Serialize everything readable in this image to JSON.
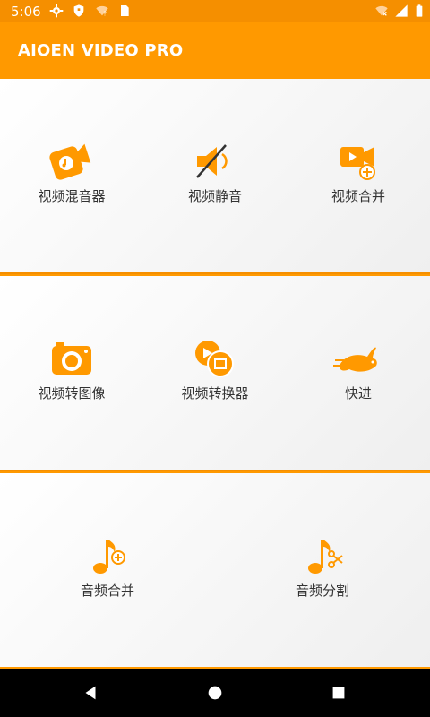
{
  "status_bar": {
    "time": "5:06",
    "left_icons": [
      "gear-icon",
      "shield-icon",
      "wifi-question-icon",
      "sim-icon"
    ],
    "right_icons": [
      "wifi-x-icon",
      "signal-icon",
      "battery-icon"
    ]
  },
  "app_bar": {
    "title": "AIOEN VIDEO PRO"
  },
  "tiles": [
    {
      "label": "视频混音器",
      "icon": "video-music-icon"
    },
    {
      "label": "视频静音",
      "icon": "mute-icon"
    },
    {
      "label": "视频合并",
      "icon": "video-add-icon"
    },
    {
      "label": "视频转图像",
      "icon": "camera-icon"
    },
    {
      "label": "视频转换器",
      "icon": "video-convert-icon"
    },
    {
      "label": "快进",
      "icon": "rabbit-icon"
    },
    {
      "label": "音频合并",
      "icon": "music-add-icon"
    },
    {
      "label": "音频分割",
      "icon": "music-cut-icon"
    }
  ],
  "colors": {
    "primary": "#ff9900",
    "tile_bg": "#f4f4f4",
    "nav_bg": "#000000"
  },
  "nav_bar": {
    "buttons": [
      "back-icon",
      "home-icon",
      "recent-apps-icon"
    ]
  }
}
